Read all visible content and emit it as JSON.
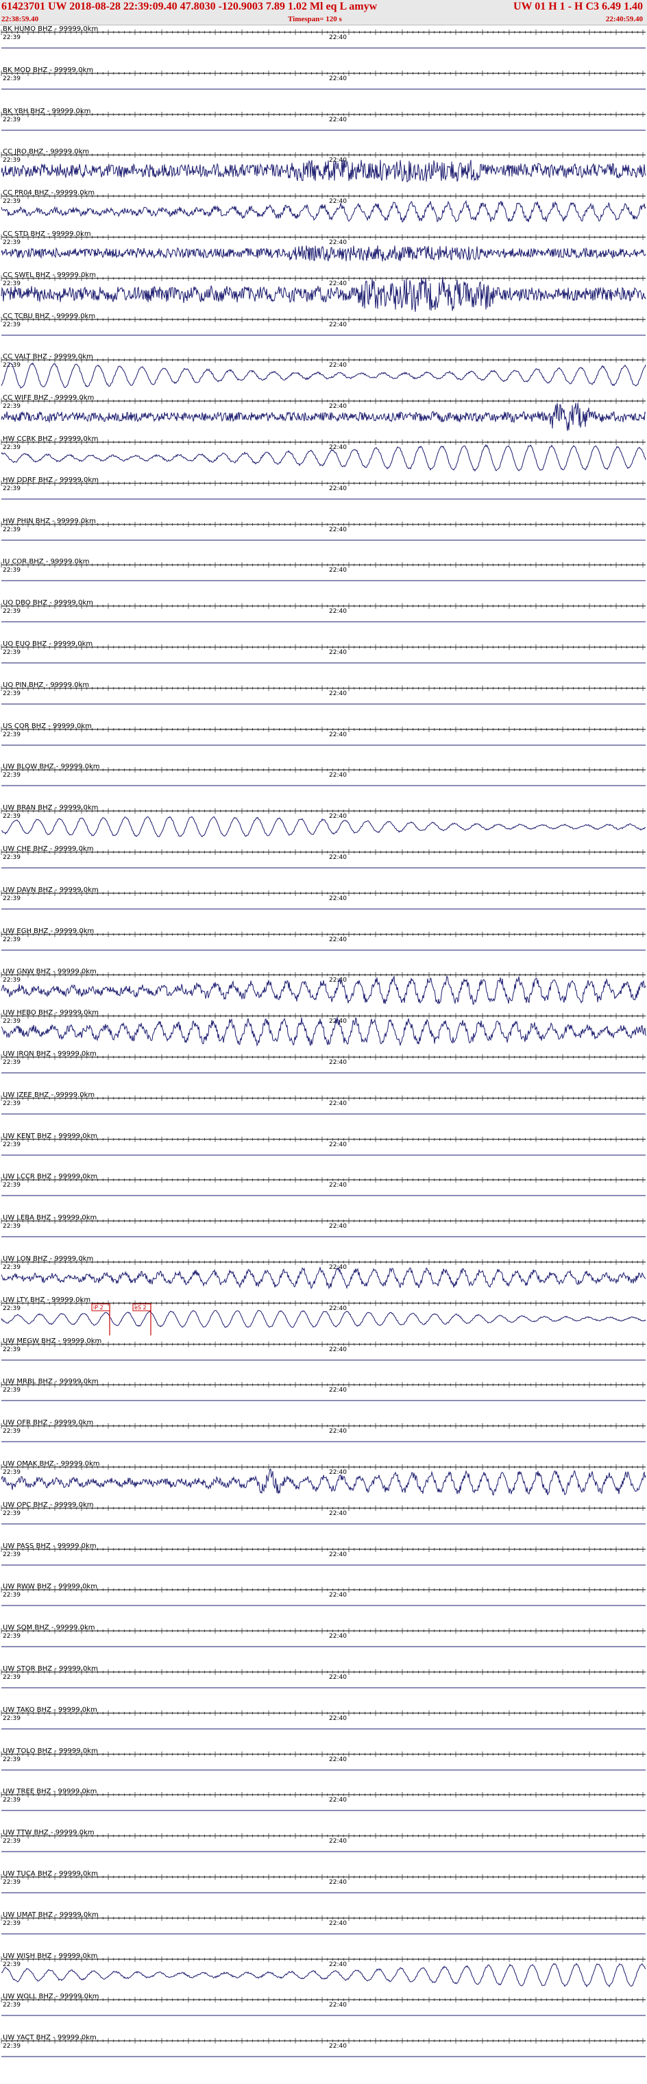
{
  "header": {
    "event": "61423701 UW 2018-08-28 22:39:09.40   47.8030 -120.9003   7.89  1.02 Ml  eq  L  amyw",
    "event_right": "UW 01  H   1  -  H C3    6.49  1.40",
    "start_time": "22:38:59.40",
    "timespan": "Timespan= 120 s",
    "end_time": "22:40:59.40"
  },
  "tick_labels": {
    "left": "22:39",
    "mid": "22:40"
  },
  "colors": {
    "trace": "#1a1a6e",
    "header_text": "#cc0000",
    "pick": "#cc0000"
  },
  "channels": [
    {
      "label": "BK HUMO BHZ - 99999.0km",
      "amp": 0,
      "style": "flat"
    },
    {
      "label": "BK MOD BHZ - 99999.0km",
      "amp": 0,
      "style": "flat"
    },
    {
      "label": "BK YBH BHZ - 99999.0km",
      "amp": 0,
      "style": "flat"
    },
    {
      "label": "CC JRO BHZ - 99999.0km",
      "amp": 10,
      "style": "noise"
    },
    {
      "label": "CC PR04 BHZ - 99999.0km",
      "amp": 12,
      "style": "mixed"
    },
    {
      "label": "CC STD BHZ - 99999.0km",
      "amp": 7,
      "style": "noise"
    },
    {
      "label": "CC SWFL BHZ - 99999.0km",
      "amp": 12,
      "style": "noise-burst"
    },
    {
      "label": "CC TCBU BHZ - 99999.0km",
      "amp": 0,
      "style": "flat"
    },
    {
      "label": "CC VALT BHZ - 99999.0km",
      "amp": 18,
      "style": "wave"
    },
    {
      "label": "CC WIFE BHZ - 99999.0km",
      "amp": 8,
      "style": "noise-event"
    },
    {
      "label": "HW CCRK BHZ - 99999.0km",
      "amp": 18,
      "style": "wave"
    },
    {
      "label": "HW DDRF BHZ - 99999.0km",
      "amp": 0,
      "style": "flat"
    },
    {
      "label": "HW PHIN BHZ - 99999.0km",
      "amp": 0,
      "style": "flat"
    },
    {
      "label": "IU COR BHZ - 99999.0km",
      "amp": 0,
      "style": "flat"
    },
    {
      "label": "UO DBO BHZ - 99999.0km",
      "amp": 0,
      "style": "flat"
    },
    {
      "label": "UO EUO BHZ - 99999.0km",
      "amp": 0,
      "style": "flat"
    },
    {
      "label": "UO PIN BHZ - 99999.0km",
      "amp": 0,
      "style": "flat"
    },
    {
      "label": "US COR BHZ - 99999.0km",
      "amp": 0,
      "style": "flat"
    },
    {
      "label": "UW BLOW BHZ - 99999.0km",
      "amp": 0,
      "style": "flat"
    },
    {
      "label": "UW BRAN BHZ - 99999.0km",
      "amp": 14,
      "style": "wave"
    },
    {
      "label": "UW CHE BHZ - 99999.0km",
      "amp": 0,
      "style": "flat"
    },
    {
      "label": "UW DAVN BHZ - 99999.0km",
      "amp": 0,
      "style": "flat"
    },
    {
      "label": "UW EGH BHZ - 99999.0km",
      "amp": 0,
      "style": "flat"
    },
    {
      "label": "UW GNW BHZ - 99999.0km",
      "amp": 16,
      "style": "mixed"
    },
    {
      "label": "UW HEBO BHZ - 99999.0km",
      "amp": 16,
      "style": "mixed"
    },
    {
      "label": "UW IRON BHZ - 99999.0km",
      "amp": 0,
      "style": "flat"
    },
    {
      "label": "UW IZEE BHZ - 99999.0km",
      "amp": 0,
      "style": "flat"
    },
    {
      "label": "UW KENT BHZ - 99999.0km",
      "amp": 0,
      "style": "flat"
    },
    {
      "label": "UW LCCR BHZ - 99999.0km",
      "amp": 0,
      "style": "flat"
    },
    {
      "label": "UW LEBA BHZ - 99999.0km",
      "amp": 0,
      "style": "flat"
    },
    {
      "label": "UW LON BHZ - 99999.0km",
      "amp": 12,
      "style": "mixed"
    },
    {
      "label": "UW LTY BHZ - 99999.0km",
      "amp": 12,
      "style": "wave-pick"
    },
    {
      "label": "UW MEGW BHZ - 99999.0km",
      "amp": 0,
      "style": "flat"
    },
    {
      "label": "UW MRBL BHZ - 99999.0km",
      "amp": 0,
      "style": "flat"
    },
    {
      "label": "UW OFR BHZ - 99999.0km",
      "amp": 0,
      "style": "flat"
    },
    {
      "label": "UW OMAK BHZ - 99999.0km",
      "amp": 14,
      "style": "mixed-event"
    },
    {
      "label": "UW OPC BHZ - 99999.0km",
      "amp": 0,
      "style": "flat"
    },
    {
      "label": "UW PASS BHZ - 99999.0km",
      "amp": 0,
      "style": "flat"
    },
    {
      "label": "UW RWW BHZ - 99999.0km",
      "amp": 0,
      "style": "flat"
    },
    {
      "label": "UW SQM BHZ - 99999.0km",
      "amp": 0,
      "style": "flat"
    },
    {
      "label": "UW STOR BHZ - 99999.0km",
      "amp": 0,
      "style": "flat"
    },
    {
      "label": "UW TAKO BHZ - 99999.0km",
      "amp": 0,
      "style": "flat"
    },
    {
      "label": "UW TOLO BHZ - 99999.0km",
      "amp": 0,
      "style": "flat"
    },
    {
      "label": "UW TREE BHZ - 99999.0km",
      "amp": 0,
      "style": "flat"
    },
    {
      "label": "UW TTW BHZ - 99999.0km",
      "amp": 0,
      "style": "flat"
    },
    {
      "label": "UW TUCA BHZ - 99999.0km",
      "amp": 0,
      "style": "flat"
    },
    {
      "label": "UW UMAT BHZ - 99999.0km",
      "amp": 0,
      "style": "flat"
    },
    {
      "label": "UW WISH BHZ - 99999.0km",
      "amp": 16,
      "style": "wave"
    },
    {
      "label": "UW WOLL BHZ - 99999.0km",
      "amp": 0,
      "style": "flat"
    },
    {
      "label": "UW YACT BHZ - 99999.0km",
      "amp": 0,
      "style": "flat"
    }
  ],
  "picks": [
    {
      "channel": "UW LTY BHZ - 99999.0km",
      "label": "iP 2"
    },
    {
      "channel": "UW LTY BHZ - 99999.0km",
      "label": "eS 2"
    }
  ]
}
